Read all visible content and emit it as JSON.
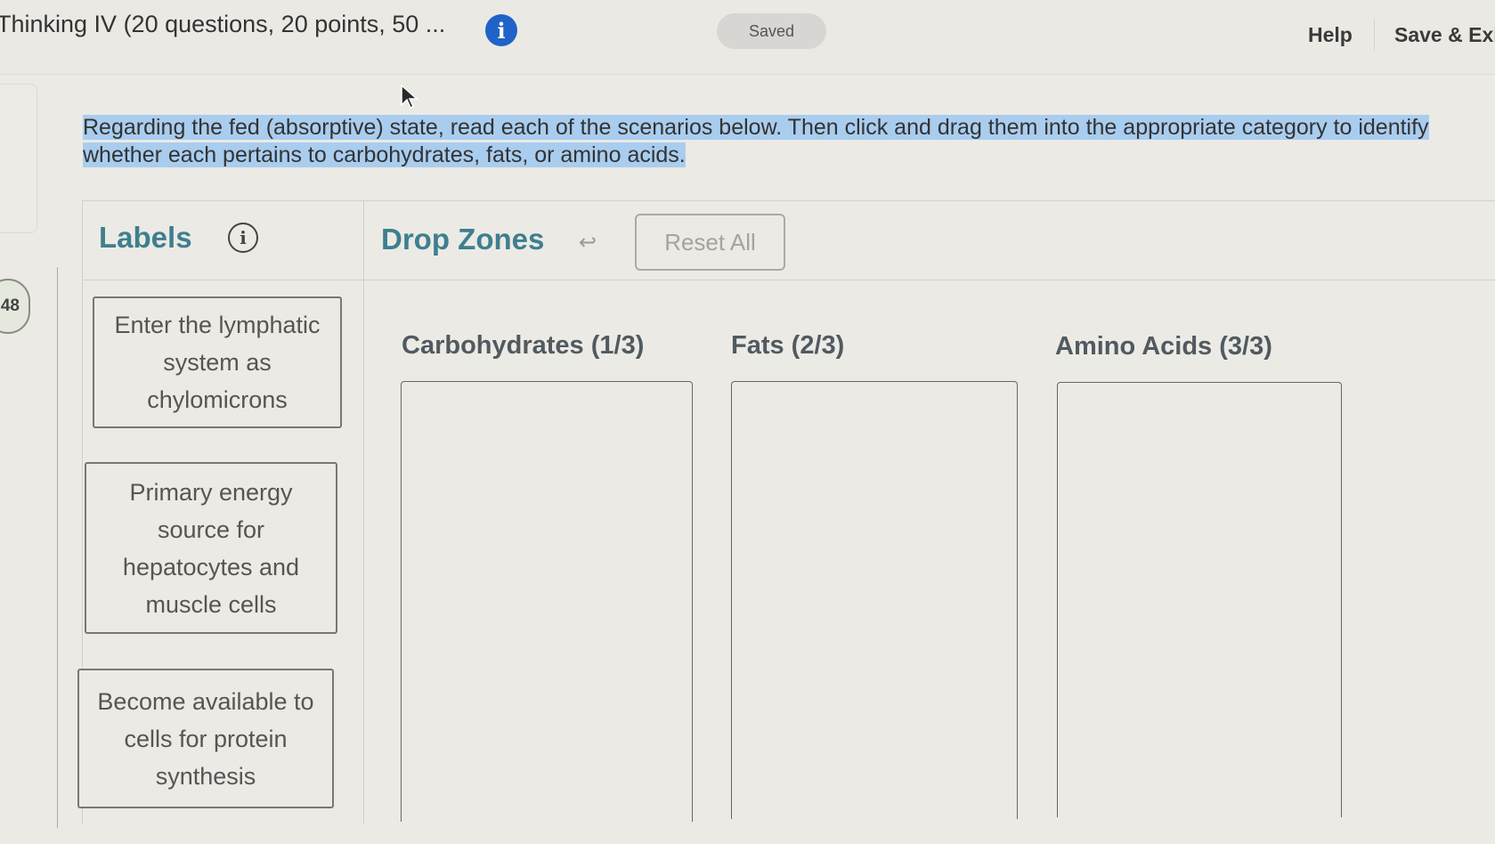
{
  "header": {
    "title": "Thinking IV (20 questions, 20 points, 50 ...",
    "info_icon": "i",
    "status": "Saved",
    "help_label": "Help",
    "save_exit_label": "Save & Exit"
  },
  "question": {
    "number": "48",
    "instruction": "Regarding the fed (absorptive) state, read each of the scenarios below. Then click and drag them into the appropriate category to identify whether each pertains to carbohydrates, fats, or amino acids."
  },
  "labels_panel": {
    "heading": "Labels",
    "info_icon": "i",
    "cards": [
      {
        "text": "Enter the lymphatic system as chylomicrons"
      },
      {
        "text": "Primary energy source for hepatocytes and muscle cells"
      },
      {
        "text": "Become available to cells for protein synthesis"
      }
    ]
  },
  "drop_panel": {
    "heading": "Drop Zones",
    "undo_icon": "↩",
    "reset_label": "Reset All",
    "zones": [
      {
        "title": "Carbohydrates (1/3)"
      },
      {
        "title": "Fats (2/3)"
      },
      {
        "title": "Amino Acids (3/3)"
      }
    ]
  },
  "colors": {
    "accent_heading": "#3e7f8e",
    "info_blue": "#1f63c9",
    "selection_highlight": "#a9cdef"
  }
}
